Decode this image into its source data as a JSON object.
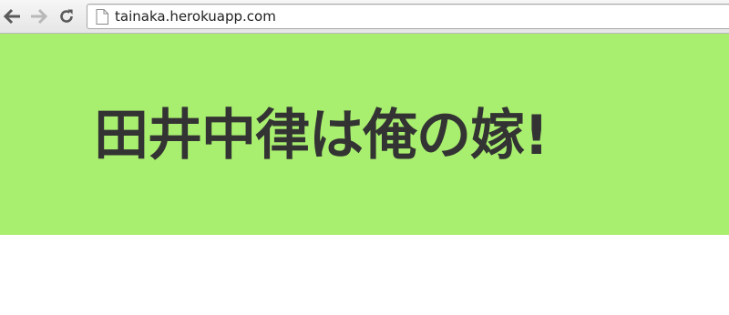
{
  "browser": {
    "url": "tainaka.herokuapp.com",
    "icons": {
      "back": "back-arrow-icon",
      "forward": "forward-arrow-icon",
      "reload": "reload-icon",
      "page": "page-document-icon"
    },
    "colors": {
      "icon_active": "#5a5a5a",
      "icon_disabled": "#b8b8b8"
    }
  },
  "hero": {
    "title": "田井中律は俺の嫁!",
    "background_color": "#a9ef6f",
    "text_color": "#333333"
  }
}
